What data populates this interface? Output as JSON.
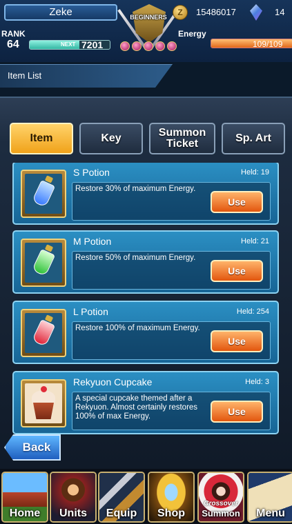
{
  "player": {
    "name": "Zeke",
    "rank_label": "RANK",
    "rank": "64",
    "next_label": "NEXT",
    "next_exp": "7201",
    "exp_progress": 0.62,
    "gold": "15486017",
    "crystals": "14",
    "energy_label": "Energy",
    "energy": "109/109",
    "energy_progress": 1.0
  },
  "emblem": {
    "text": "BEGINNERS",
    "icon": "beginners-crest-icon"
  },
  "page": {
    "title": "Item List"
  },
  "tabs": [
    {
      "label": "Item",
      "active": true
    },
    {
      "label": "Key",
      "active": false
    },
    {
      "label": "Summon Ticket",
      "active": false
    },
    {
      "label": "Sp. Art",
      "active": false
    }
  ],
  "items": [
    {
      "name": "S Potion",
      "held": "Held: 19",
      "description": "Restore 30% of maximum Energy.",
      "use_label": "Use",
      "icon": "blue-potion-icon",
      "color": "#3a7bff"
    },
    {
      "name": "M Potion",
      "held": "Held: 21",
      "description": "Restore 50% of maximum Energy.",
      "use_label": "Use",
      "icon": "green-potion-icon",
      "color": "#2fc23a"
    },
    {
      "name": "L Potion",
      "held": "Held: 254",
      "description": "Restore 100% of maximum Energy.",
      "use_label": "Use",
      "icon": "red-potion-icon",
      "color": "#e0263a"
    },
    {
      "name": "Rekyuon Cupcake",
      "held": "Held: 3",
      "description": "A special cupcake themed after a Rekyuon. Almost certainly restores 100% of max Energy.",
      "use_label": "Use",
      "icon": "cupcake-icon",
      "color": "#b8502e"
    }
  ],
  "back_label": "Back",
  "nav": [
    {
      "label": "Home",
      "icon": "home-icon"
    },
    {
      "label": "Units",
      "icon": "units-icon"
    },
    {
      "label": "Equip",
      "icon": "equip-icon"
    },
    {
      "label": "Shop",
      "icon": "shop-icon"
    },
    {
      "label": "Summon",
      "sub": "Crossover",
      "icon": "summon-icon"
    },
    {
      "label": "Menu",
      "icon": "menu-icon"
    }
  ]
}
